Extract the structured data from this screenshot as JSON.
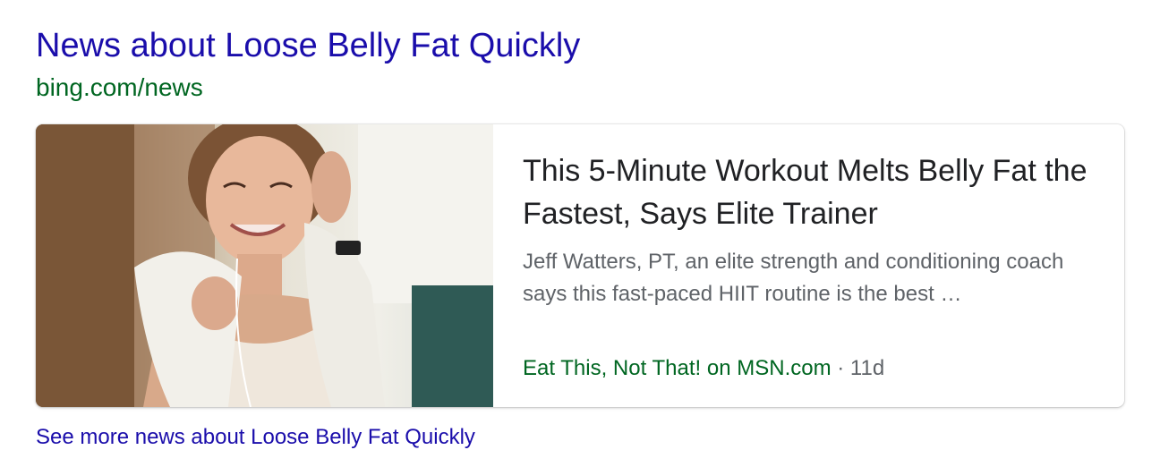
{
  "result": {
    "title": "News about Loose Belly Fat Quickly",
    "source_url": "bing.com/news"
  },
  "news_card": {
    "image_icon": "workout-photo",
    "headline": "This 5-Minute Workout Melts Belly Fat the Fastest, Says Elite Trainer",
    "snippet": "Jeff Watters, PT, an elite strength and conditioning coach says this fast-paced HIIT routine is the best …",
    "publisher": "Eat This, Not That! on MSN.com",
    "separator": "·",
    "age": "11d"
  },
  "more_link": "See more news about Loose Belly Fat Quickly",
  "colors": {
    "link": "#1a0dab",
    "url_green": "#006621",
    "headline": "#202124",
    "snippet": "#5f6368"
  }
}
